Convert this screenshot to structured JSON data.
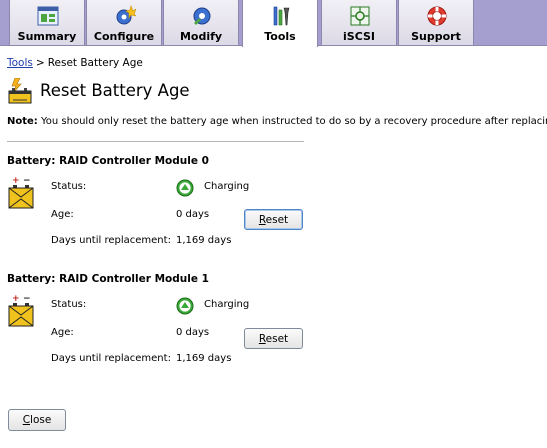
{
  "tabs": [
    {
      "label": "Summary",
      "icon": "summary-icon",
      "active": false
    },
    {
      "label": "Configure",
      "icon": "configure-icon",
      "active": false
    },
    {
      "label": "Modify",
      "icon": "modify-icon",
      "active": false
    },
    {
      "label": "Tools",
      "icon": "tools-icon",
      "active": true
    },
    {
      "label": "iSCSI",
      "icon": "iscsi-icon",
      "active": false
    },
    {
      "label": "Support",
      "icon": "support-icon",
      "active": false
    }
  ],
  "breadcrumb": {
    "link": "Tools",
    "separator": ">",
    "current": "Reset Battery Age"
  },
  "page": {
    "title": "Reset Battery Age"
  },
  "note": {
    "label": "Note:",
    "text": "You should only reset the battery age when instructed to do so by a recovery procedure after replacing a"
  },
  "batteries": [
    {
      "heading": "Battery: RAID Controller Module 0",
      "status_label": "Status:",
      "status": "Charging",
      "age_label": "Age:",
      "age": "0 days",
      "days_label": "Days until replacement:",
      "days": "1,169 days",
      "reset_mnemonic": "R",
      "reset_rest": "eset"
    },
    {
      "heading": "Battery: RAID Controller Module 1",
      "status_label": "Status:",
      "status": "Charging",
      "age_label": "Age:",
      "age": "0 days",
      "days_label": "Days until replacement:",
      "days": "1,169 days",
      "reset_mnemonic": "R",
      "reset_rest": "eset"
    }
  ],
  "footer": {
    "close_mnemonic": "C",
    "close_rest": "lose"
  },
  "colors": {
    "tabbar": "#a49fcf",
    "link": "#1e3fb0",
    "status_ok": "#3aa836"
  }
}
